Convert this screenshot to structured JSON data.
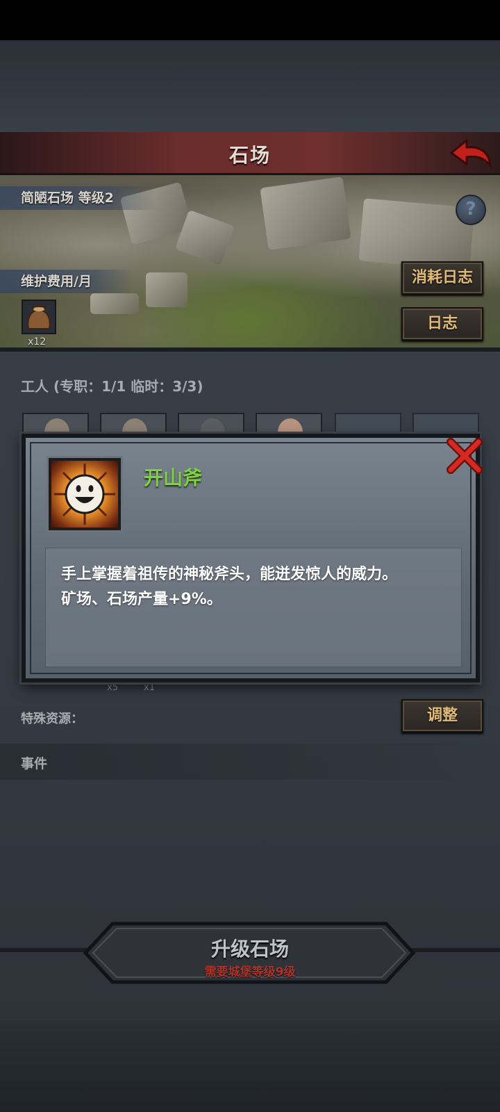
{
  "header": {
    "title": "石场"
  },
  "building": {
    "name_level": "简陋石场 等级2",
    "maintenance_label": "维护费用/月",
    "maintenance_qty": "x12",
    "btn_consumption_log": "消耗日志",
    "btn_log": "日志"
  },
  "workers": {
    "label": "工人 (专职：1/1 临时：3/3)"
  },
  "popup": {
    "title": "开山斧",
    "description_line1": "手上掌握着祖传的神秘斧头，能迸发惊人的威力。",
    "description_line2": "矿场、石场产量+9%。"
  },
  "resources_peek": {
    "qty1": "x5",
    "qty2": "x1"
  },
  "special_resources": {
    "label": "特殊资源：",
    "adjust_button": "调整"
  },
  "events": {
    "label": "事件"
  },
  "upgrade": {
    "title": "升级石场",
    "requirement": "需要城堡等级9级"
  },
  "colors": {
    "accent_gold": "#e2bb77",
    "title_green": "#7fd23f",
    "warning_red": "#a9352d"
  },
  "icons": [
    "back-arrow-icon",
    "help-icon",
    "sack-icon",
    "close-icon",
    "smiley-sun-icon"
  ]
}
